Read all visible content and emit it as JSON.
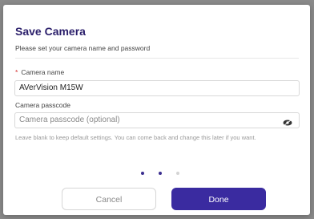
{
  "dialog": {
    "title": "Save Camera",
    "subtitle": "Please set your camera name and password",
    "camera_name": {
      "required_mark": "*",
      "label": "Camera name",
      "value": "AVerVision M15W"
    },
    "camera_passcode": {
      "label": "Camera passcode",
      "placeholder": "Camera passcode (optional)",
      "toggle_icon": "eye-icon"
    },
    "hint": "Leave blank to keep default settings. You can come back and change this later if you want.",
    "steps": {
      "total": 3,
      "current": 2
    },
    "buttons": {
      "cancel_label": "Cancel",
      "done_label": "Done"
    }
  },
  "colors": {
    "accent": "#3a2ba0",
    "title": "#2b1f6b",
    "required": "#d32f2f"
  }
}
